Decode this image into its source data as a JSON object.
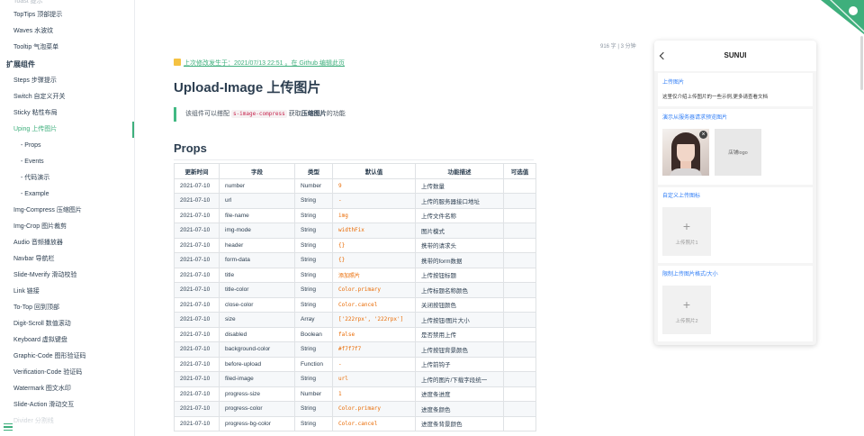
{
  "sidebar": {
    "top_items": [
      "Toast 提示",
      "TopTips 顶部提示",
      "Waves 水波纹",
      "Tooltip 气泡菜单"
    ],
    "group_label": "扩展组件",
    "items_before": [
      "Steps 步骤提示",
      "Switch 自定义开关",
      "Sticky 粘性布局"
    ],
    "active_item": "Uping 上传图片",
    "sub_items": [
      "- Props",
      "- Events",
      "- 代码演示",
      "- Example"
    ],
    "items_after": [
      "Img-Compress 压缩图片",
      "Img-Crop 图片裁剪",
      "Audio 音频播放器",
      "Navbar 导航栏",
      "Slide-Mverify 滑动校验",
      "Link 链接",
      "To-Top 回到顶部",
      "Digit-Scroll 数值滚动",
      "Keyboard 虚拟键盘",
      "Graphic-Code 图形验证码",
      "Verification-Code 验证码",
      "Watermark 图文水印",
      "Slide-Action 滑动交互",
      "Divider 分割线"
    ],
    "accent_color": "#3eaf7c"
  },
  "meta": {
    "word_count": "916 字",
    "separator": "|",
    "read_time": "3 分钟"
  },
  "page": {
    "last_modified": "上次修改发生于：2021/07/13 22:51 。在 Github 编辑此页",
    "title": "Upload-Image 上传图片",
    "tip_prefix": "该组件可以搭配",
    "tip_code": "s-image-compress",
    "tip_mid": "获取",
    "tip_bold": "压缩图片",
    "tip_suffix": "的功能",
    "section_title": "Props"
  },
  "table": {
    "headers": [
      "更新时间",
      "字段",
      "类型",
      "默认值",
      "功能描述",
      "可选值"
    ],
    "rows": [
      [
        "2021-07-10",
        "number",
        "Number",
        "9",
        "上传数量",
        ""
      ],
      [
        "2021-07-10",
        "url",
        "String",
        "-",
        "上传的服务器接口地址",
        ""
      ],
      [
        "2021-07-10",
        "file-name",
        "String",
        "img",
        "上传文件名称",
        ""
      ],
      [
        "2021-07-10",
        "img-mode",
        "String",
        "widthFix",
        "图片模式",
        ""
      ],
      [
        "2021-07-10",
        "header",
        "String",
        "{}",
        "携带的请求头",
        ""
      ],
      [
        "2021-07-10",
        "form-data",
        "String",
        "{}",
        "携带的form数据",
        ""
      ],
      [
        "2021-07-10",
        "title",
        "String",
        "添加照片",
        "上传按钮标题",
        ""
      ],
      [
        "2021-07-10",
        "title-color",
        "String",
        "Color.primary",
        "上传标题名称颜色",
        ""
      ],
      [
        "2021-07-10",
        "close-color",
        "String",
        "Color.cancel",
        "关闭按钮颜色",
        ""
      ],
      [
        "2021-07-10",
        "size",
        "Array",
        "['222rpx', '222rpx']",
        "上传按钮/图片大小",
        ""
      ],
      [
        "2021-07-10",
        "disabled",
        "Boolean",
        "false",
        "是否禁用上传",
        ""
      ],
      [
        "2021-07-10",
        "background-color",
        "String",
        "#f7f7f7",
        "上传按钮背景颜色",
        ""
      ],
      [
        "2021-07-10",
        "before-upload",
        "Function",
        "-",
        "上传前钩子",
        ""
      ],
      [
        "2021-07-10",
        "filed-image",
        "String",
        "url",
        "上传的图片/下载字段统一",
        ""
      ],
      [
        "2021-07-10",
        "progress-size",
        "Number",
        "1",
        "进度条进度",
        ""
      ],
      [
        "2021-07-10",
        "progress-color",
        "String",
        "Color.primary",
        "进度条颜色",
        ""
      ],
      [
        "2021-07-10",
        "progress-bg-color",
        "String",
        "Color.cancel",
        "进度条背景颜色",
        ""
      ]
    ]
  },
  "phone": {
    "nav_title": "SUNUI",
    "card1_title": "上传图片",
    "card1_desc": "这里仅介绍上传图片的一些示例,更多请查看文档",
    "card2_title": "演示从服务器请求预览图片",
    "logo_label": "店铺logo",
    "card3_title": "自定义上传图标",
    "upload1_label": "上传照片1",
    "card4_title": "限制上传图片格式/大小",
    "upload2_label": "上传照片2",
    "plus_glyph": "+",
    "close_glyph": "×"
  }
}
